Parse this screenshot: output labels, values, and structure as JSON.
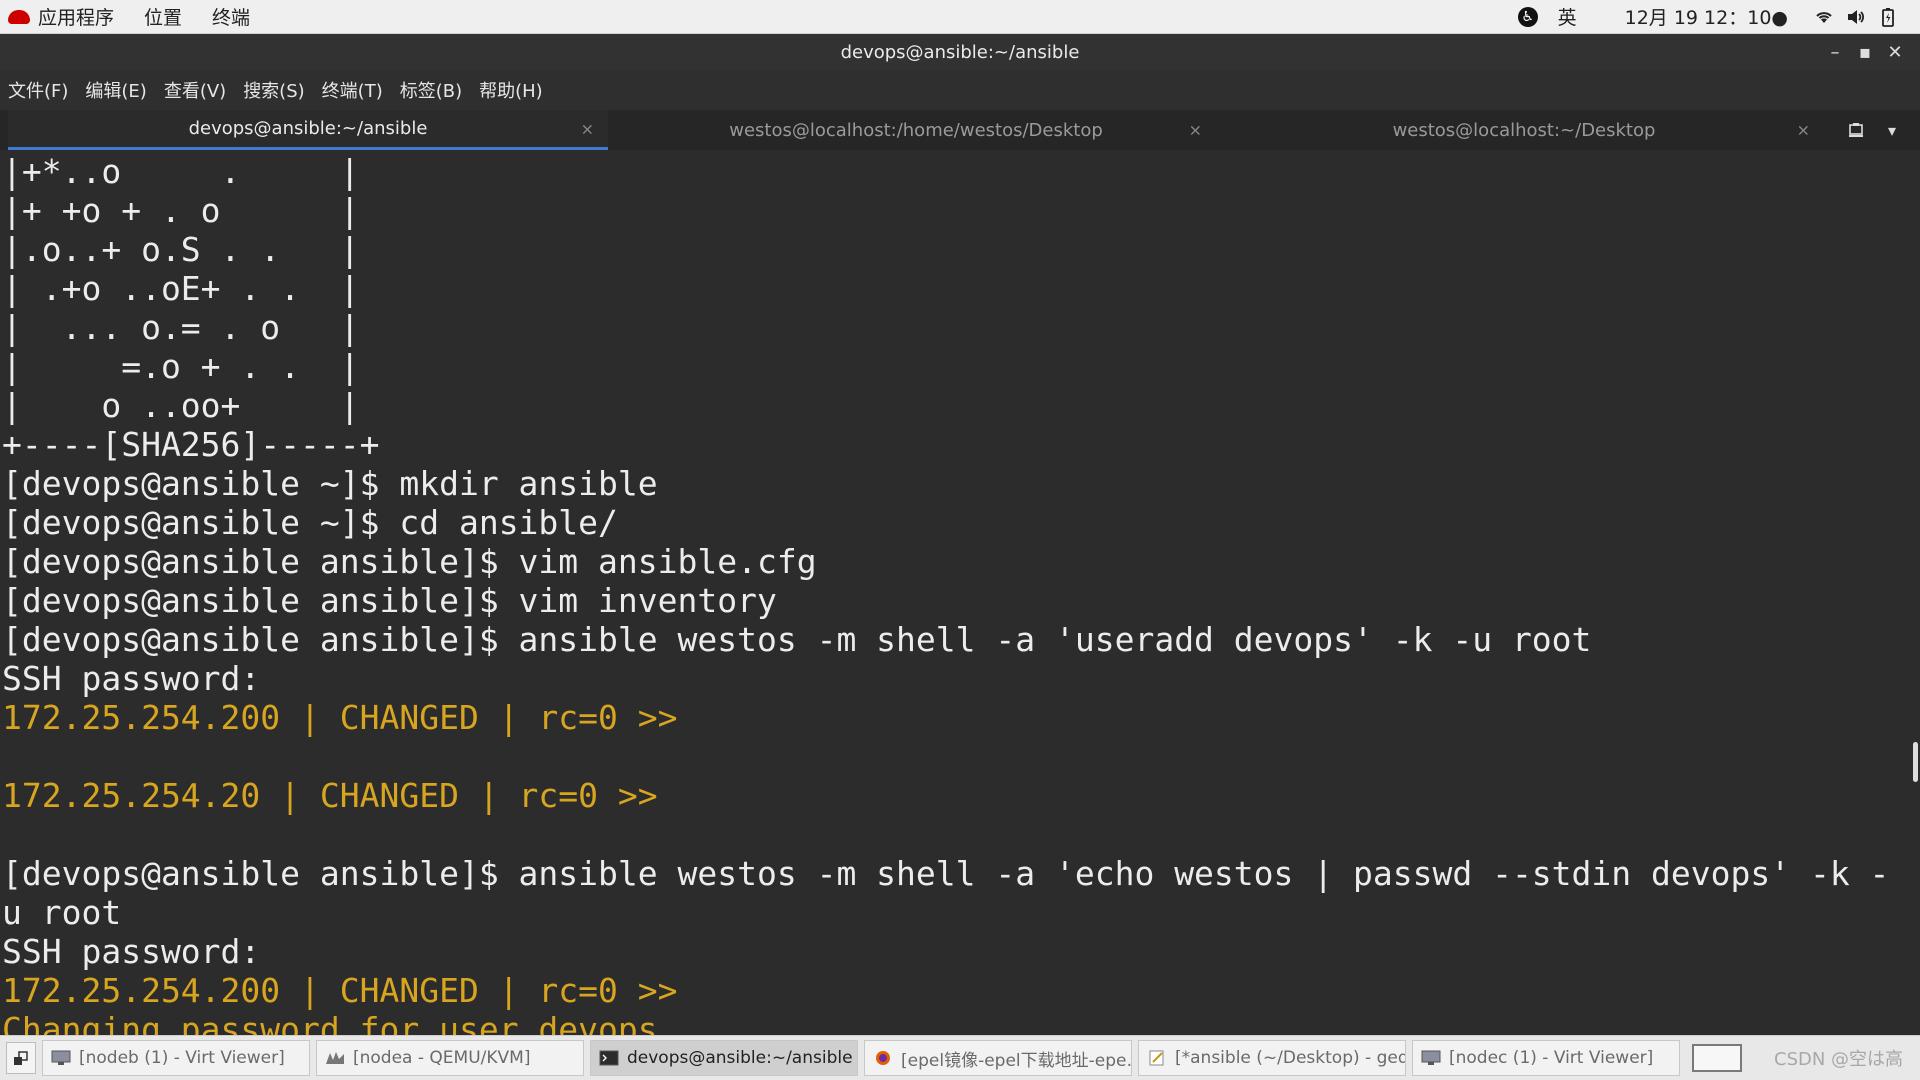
{
  "topbar": {
    "apps": "应用程序",
    "places": "位置",
    "terminal": "终端",
    "ime": "英",
    "clock": "12月 19 12：10●",
    "icons": [
      "accessibility-icon",
      "wifi-icon",
      "volume-icon",
      "battery-icon"
    ]
  },
  "window": {
    "title": "devops@ansible:~/ansible"
  },
  "menubar": {
    "items": [
      "文件(F)",
      "编辑(E)",
      "查看(V)",
      "搜索(S)",
      "终端(T)",
      "标签(B)",
      "帮助(H)"
    ]
  },
  "tabs": [
    {
      "label": "devops@ansible:~/ansible",
      "active": true
    },
    {
      "label": "westos@localhost:/home/westos/Desktop",
      "active": false
    },
    {
      "label": "westos@localhost:~/Desktop",
      "active": false
    }
  ],
  "terminal": {
    "lines": [
      "|+*..o     .     |",
      "|+ +o + . o      |",
      "|.o..+ o.S . .   |",
      "| .+o ..oE+ . .  |",
      "|  ... o.= . o   |",
      "|     =.o + . .  |",
      "|    o ..oo+     |",
      "+----[SHA256]-----+",
      "[devops@ansible ~]$ mkdir ansible",
      "[devops@ansible ~]$ cd ansible/",
      "[devops@ansible ansible]$ vim ansible.cfg",
      "[devops@ansible ansible]$ vim inventory",
      "[devops@ansible ansible]$ ansible westos -m shell -a 'useradd devops' -k -u root",
      "SSH password:",
      "172.25.254.200 | CHANGED | rc=0 >>",
      "",
      "172.25.254.20 | CHANGED | rc=0 >>",
      "",
      "[devops@ansible ansible]$ ansible westos -m shell -a 'echo westos | passwd --stdin devops' -k -",
      "u root",
      "SSH password:",
      "172.25.254.200 | CHANGED | rc=0 >>",
      "Changing password for user devops."
    ],
    "yellow_lines": [
      14,
      16,
      21,
      22
    ],
    "output_color": "#d8a520",
    "text_color": "#ececec",
    "background": "#2c2c2c"
  },
  "taskbar": {
    "tasks": [
      {
        "label": "[nodeb (1) - Virt Viewer]",
        "icon": "monitor-icon",
        "active": false
      },
      {
        "label": "[nodea - QEMU/KVM]",
        "icon": "kvm-icon",
        "active": false
      },
      {
        "label": "devops@ansible:~/ansible",
        "icon": "terminal-icon",
        "active": true
      },
      {
        "label": "[epel镜像-epel下载地址-epe…",
        "icon": "firefox-icon",
        "active": false
      },
      {
        "label": "[*ansible (~/Desktop) - gedit]",
        "icon": "gedit-icon",
        "active": false
      },
      {
        "label": "[nodec (1) - Virt Viewer]",
        "icon": "monitor-icon",
        "active": false
      }
    ],
    "watermark": "CSDN @空は高"
  }
}
